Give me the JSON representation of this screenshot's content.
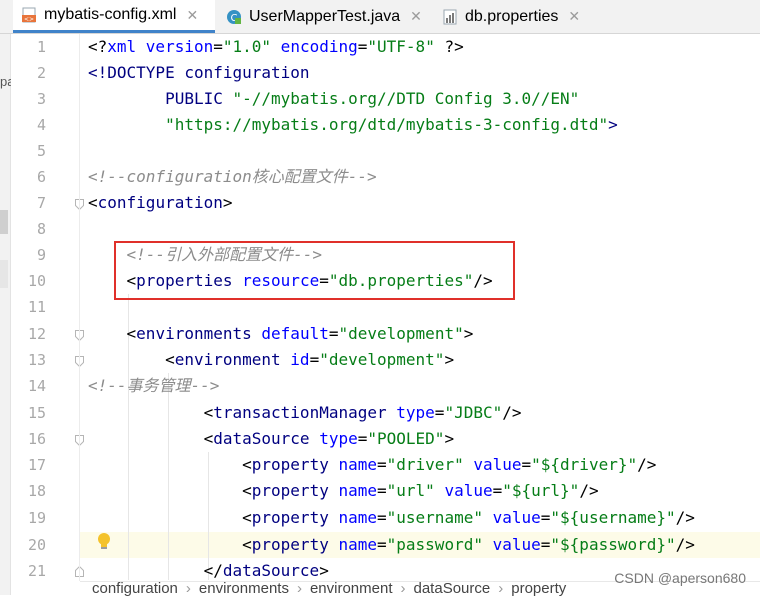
{
  "tabs": [
    {
      "label": "mybatis-config.xml",
      "icon": "xml-file-icon",
      "active": true
    },
    {
      "label": "UserMapperTest.java",
      "icon": "java-class-icon",
      "active": false
    },
    {
      "label": "db.properties",
      "icon": "properties-file-icon",
      "active": false
    }
  ],
  "left_fragment": "pa",
  "line_numbers": [
    "1",
    "2",
    "3",
    "4",
    "5",
    "6",
    "7",
    "8",
    "9",
    "10",
    "11",
    "12",
    "13",
    "14",
    "15",
    "16",
    "17",
    "18",
    "19",
    "20",
    "21"
  ],
  "code": {
    "l1": {
      "a": "<?",
      "b": "xml ",
      "c": "version",
      "d": "=",
      "e": "\"1.0\"",
      "f": " encoding",
      "g": "=",
      "h": "\"UTF-8\"",
      "i": " ?>"
    },
    "l2": {
      "a": "<!DOCTYPE ",
      "b": "configuration"
    },
    "l3": {
      "a": "        PUBLIC ",
      "b": "\"-//mybatis.org//DTD Config 3.0//EN\""
    },
    "l4": {
      "a": "        \"https://mybatis.org/dtd/mybatis-3-config.dtd\"",
      "b": ">"
    },
    "l6": "<!--configuration核心配置文件-->",
    "l7": {
      "a": "<",
      "b": "configuration",
      "c": ">"
    },
    "l9": "    <!--引入外部配置文件-->",
    "l10": {
      "a": "    <",
      "b": "properties ",
      "c": "resource",
      "d": "=",
      "e": "\"db.properties\"",
      "f": "/>"
    },
    "l12": {
      "a": "    <",
      "b": "environments ",
      "c": "default",
      "d": "=",
      "e": "\"development\"",
      "f": ">"
    },
    "l13": {
      "a": "        <",
      "b": "environment ",
      "c": "id",
      "d": "=",
      "e": "\"development\"",
      "f": ">"
    },
    "l14": "<!--事务管理-->",
    "l15": {
      "a": "            <",
      "b": "transactionManager ",
      "c": "type",
      "d": "=",
      "e": "\"JDBC\"",
      "f": "/>"
    },
    "l16": {
      "a": "            <",
      "b": "dataSource ",
      "c": "type",
      "d": "=",
      "e": "\"POOLED\"",
      "f": ">"
    },
    "l17": {
      "a": "                <",
      "b": "property ",
      "c": "name",
      "d": "=",
      "e": "\"driver\"",
      "f": " value",
      "g": "=",
      "h": "\"${driver}\"",
      "i": "/>"
    },
    "l18": {
      "a": "                <",
      "b": "property ",
      "c": "name",
      "d": "=",
      "e": "\"url\"",
      "f": " value",
      "g": "=",
      "h": "\"${url}\"",
      "i": "/>"
    },
    "l19": {
      "a": "                <",
      "b": "property ",
      "c": "name",
      "d": "=",
      "e": "\"username\"",
      "f": " value",
      "g": "=",
      "h": "\"${username}\"",
      "i": "/>"
    },
    "l20": {
      "a": "                <",
      "b": "property ",
      "c": "name",
      "d": "=",
      "e": "\"password\"",
      "f": " value",
      "g": "=",
      "h": "\"${password}\"",
      "i": "/>"
    },
    "l21": {
      "a": "            </",
      "b": "dataSource",
      "c": ">"
    }
  },
  "breadcrumb": [
    "configuration",
    "environments",
    "environment",
    "dataSource",
    "property"
  ],
  "watermark": "CSDN @aperson680",
  "colors": {
    "tag": "#000080",
    "attribute": "#0000ff",
    "string": "#067d17",
    "comment": "#8c8c8c",
    "highlight_box": "#e0302a"
  }
}
